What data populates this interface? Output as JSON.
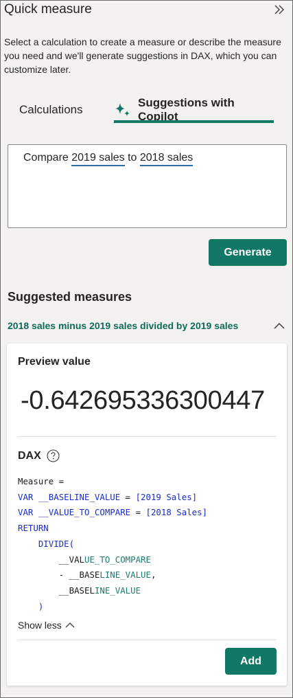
{
  "panel": {
    "title": "Quick measure",
    "collapse_icon": "double-chevron-right-icon",
    "description": "Select a calculation to create a measure or describe the measure you need and we'll generate suggestions in DAX, which you can customize later."
  },
  "tabs": [
    {
      "label": "Calculations",
      "selected": false
    },
    {
      "label": "Suggestions with Copilot",
      "selected": true,
      "icon": "copilot-sparkle-icon"
    }
  ],
  "prompt": {
    "prefix": "Compare ",
    "token1": "2019 sales",
    "middle": " to ",
    "token2": "2018 sales"
  },
  "generate_label": "Generate",
  "suggested": {
    "heading": "Suggested measures",
    "item_label": "2018 sales minus 2019 sales divided by 2019 sales",
    "expanded": true
  },
  "card": {
    "preview_label": "Preview value",
    "preview_value": "-0.642695336300447",
    "dax_label": "DAX",
    "code": {
      "l1": "Measure =",
      "l2_kw": "VAR",
      "l2_var": " __BASELINE_VALUE ",
      "l2_eq": "= ",
      "l2_ref": "[2019 Sales]",
      "l3_kw": "VAR",
      "l3_var": " __VALUE_TO_COMPARE ",
      "l3_eq": "= ",
      "l3_ref": "[2018 Sales]",
      "l4_kw": "RETURN",
      "l5_kw": "DIVIDE(",
      "l6_a": "__VAL",
      "l6_b": "UE_TO_COMPARE",
      "l7_a": "- __BASE",
      "l7_b": "LINE_VALUE",
      "l7_c": ",",
      "l8_a": "__BASEL",
      "l8_b": "INE_VALUE",
      "l9": ")"
    },
    "show_less_label": "Show less",
    "add_label": "Add"
  },
  "colors": {
    "accent": "#117865",
    "link_underline": "#2b6da8",
    "keyword": "#1a2bc9"
  }
}
